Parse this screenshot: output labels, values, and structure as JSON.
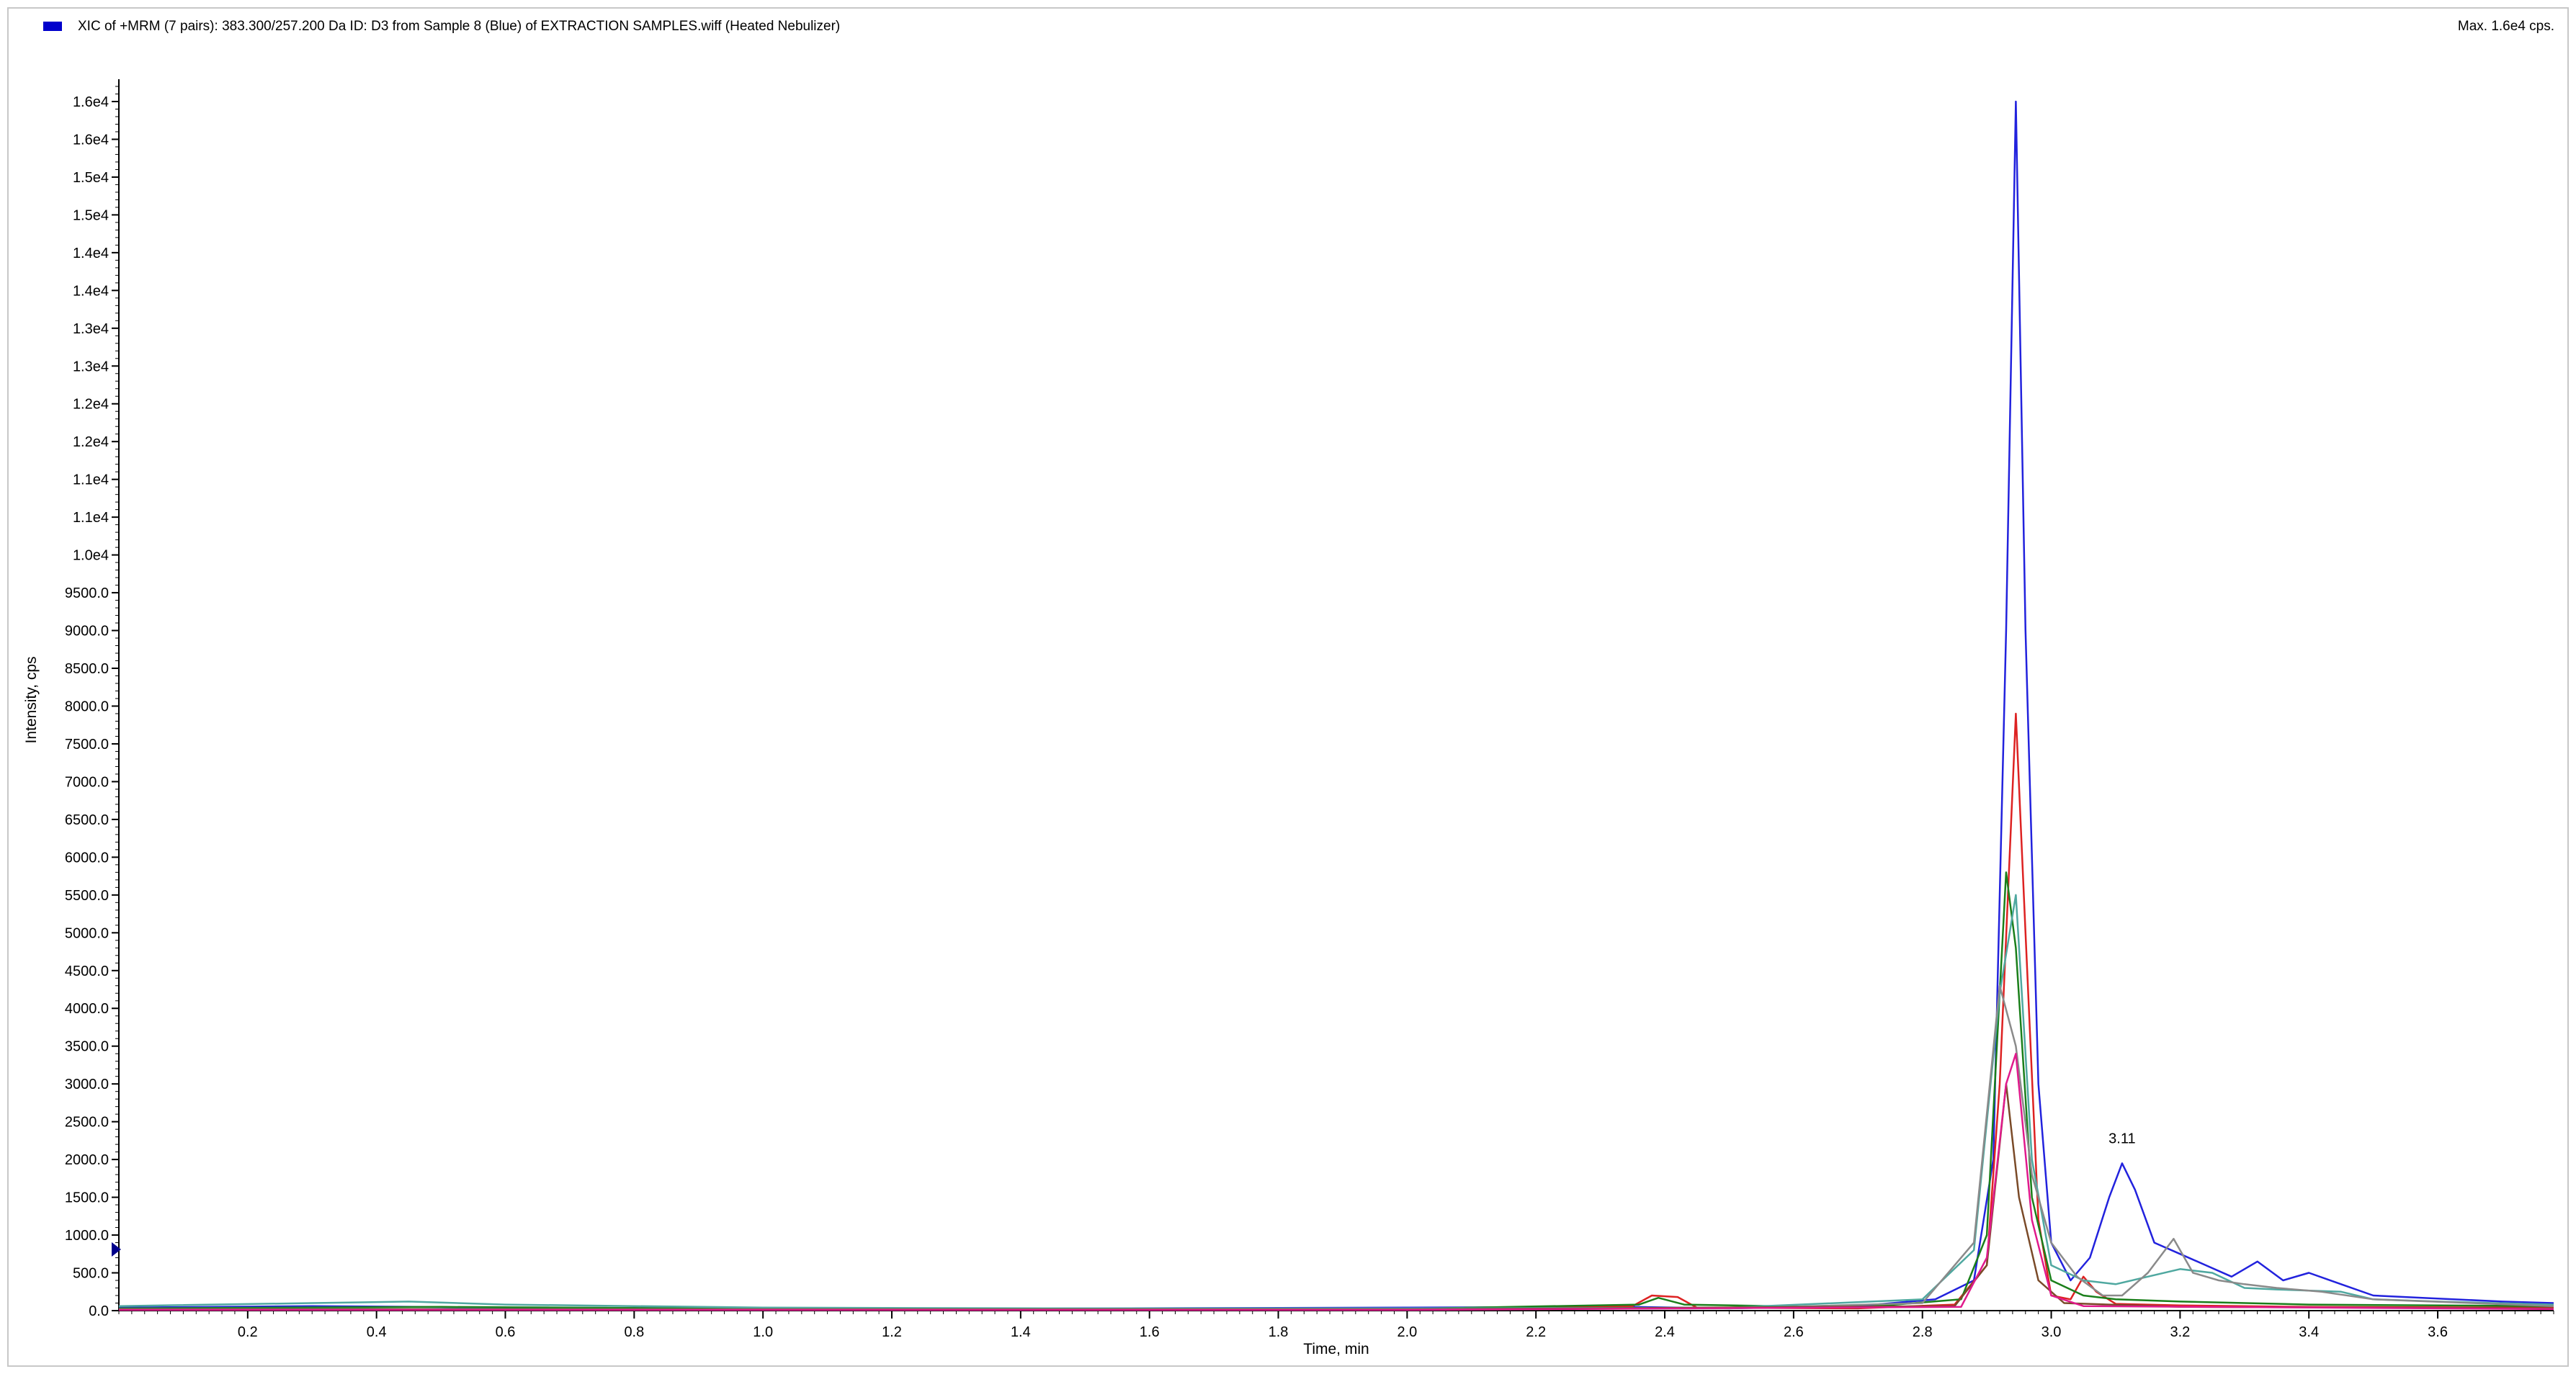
{
  "header": {
    "title": "XIC of +MRM (7 pairs): 383.300/257.200 Da ID: D3 from Sample 8 (Blue) of EXTRACTION SAMPLES.wiff (Heated Nebulizer)",
    "max": "Max. 1.6e4 cps."
  },
  "colors": {
    "legend": "#0000cc"
  },
  "chart_data": {
    "type": "line",
    "xlabel": "Time, min",
    "ylabel": "Intensity, cps",
    "xlim": [
      0.0,
      3.78
    ],
    "ylim": [
      0,
      16200
    ],
    "y_tick_values": [
      0,
      500,
      1000,
      1500,
      2000,
      2500,
      3000,
      3500,
      4000,
      4500,
      5000,
      5500,
      6000,
      6500,
      7000,
      7500,
      8000,
      8500,
      9000,
      9500,
      10000,
      10500,
      11000,
      11500,
      12000,
      12500,
      13000,
      13500,
      14000,
      14500,
      15000,
      15500,
      16000
    ],
    "y_tick_labels": [
      "0.0",
      "500.0",
      "1000.0",
      "1500.0",
      "2000.0",
      "2500.0",
      "3000.0",
      "3500.0",
      "4000.0",
      "4500.0",
      "5000.0",
      "5500.0",
      "6000.0",
      "6500.0",
      "7000.0",
      "7500.0",
      "8000.0",
      "8500.0",
      "9000.0",
      "9500.0",
      "1.0e4",
      "1.1e4",
      "1.1e4",
      "1.2e4",
      "1.2e4",
      "1.3e4",
      "1.3e4",
      "1.4e4",
      "1.4e4",
      "1.5e4",
      "1.5e4",
      "1.6e4",
      "1.6e4"
    ],
    "x_tick_values": [
      0.2,
      0.4,
      0.6,
      0.8,
      1.0,
      1.2,
      1.4,
      1.6,
      1.8,
      2.0,
      2.2,
      2.4,
      2.6,
      2.8,
      3.0,
      3.2,
      3.4,
      3.6
    ],
    "x_tick_labels": [
      "0.2",
      "0.4",
      "0.6",
      "0.8",
      "1.0",
      "1.2",
      "1.4",
      "1.6",
      "1.8",
      "2.0",
      "2.2",
      "2.4",
      "2.6",
      "2.8",
      "3.0",
      "3.2",
      "3.4",
      "3.6"
    ],
    "annotations": [
      {
        "text": "3.11",
        "x": 3.11,
        "y": 2100
      }
    ],
    "series": [
      {
        "color": "#2222dd",
        "points": [
          [
            0,
            40
          ],
          [
            0.3,
            60
          ],
          [
            0.6,
            40
          ],
          [
            1.0,
            30
          ],
          [
            1.5,
            30
          ],
          [
            2.0,
            40
          ],
          [
            2.35,
            50
          ],
          [
            2.5,
            30
          ],
          [
            2.7,
            60
          ],
          [
            2.82,
            150
          ],
          [
            2.88,
            400
          ],
          [
            2.91,
            2000
          ],
          [
            2.93,
            9000
          ],
          [
            2.945,
            16000
          ],
          [
            2.96,
            9000
          ],
          [
            2.98,
            3000
          ],
          [
            3.0,
            900
          ],
          [
            3.03,
            400
          ],
          [
            3.06,
            700
          ],
          [
            3.09,
            1500
          ],
          [
            3.11,
            1950
          ],
          [
            3.13,
            1600
          ],
          [
            3.16,
            900
          ],
          [
            3.2,
            750
          ],
          [
            3.24,
            600
          ],
          [
            3.28,
            450
          ],
          [
            3.32,
            650
          ],
          [
            3.36,
            400
          ],
          [
            3.4,
            500
          ],
          [
            3.45,
            350
          ],
          [
            3.5,
            200
          ],
          [
            3.6,
            160
          ],
          [
            3.7,
            120
          ],
          [
            3.78,
            100
          ]
        ]
      },
      {
        "color": "#dd2222",
        "points": [
          [
            0,
            20
          ],
          [
            1.0,
            15
          ],
          [
            2.0,
            20
          ],
          [
            2.35,
            60
          ],
          [
            2.38,
            200
          ],
          [
            2.42,
            180
          ],
          [
            2.45,
            40
          ],
          [
            2.7,
            30
          ],
          [
            2.85,
            80
          ],
          [
            2.9,
            600
          ],
          [
            2.92,
            3000
          ],
          [
            2.945,
            7900
          ],
          [
            2.96,
            5000
          ],
          [
            2.98,
            1200
          ],
          [
            3.0,
            200
          ],
          [
            3.03,
            150
          ],
          [
            3.05,
            450
          ],
          [
            3.07,
            250
          ],
          [
            3.1,
            90
          ],
          [
            3.2,
            70
          ],
          [
            3.4,
            50
          ],
          [
            3.78,
            40
          ]
        ]
      },
      {
        "color": "#1a7f1a",
        "points": [
          [
            0,
            30
          ],
          [
            0.5,
            50
          ],
          [
            1.0,
            25
          ],
          [
            2.0,
            25
          ],
          [
            2.36,
            80
          ],
          [
            2.39,
            170
          ],
          [
            2.43,
            80
          ],
          [
            2.7,
            40
          ],
          [
            2.86,
            150
          ],
          [
            2.9,
            1000
          ],
          [
            2.93,
            5800
          ],
          [
            2.945,
            4800
          ],
          [
            2.97,
            1500
          ],
          [
            3.0,
            400
          ],
          [
            3.05,
            200
          ],
          [
            3.1,
            150
          ],
          [
            3.2,
            120
          ],
          [
            3.4,
            80
          ],
          [
            3.78,
            60
          ]
        ]
      },
      {
        "color": "#4fa8a0",
        "points": [
          [
            0,
            60
          ],
          [
            0.3,
            100
          ],
          [
            0.45,
            120
          ],
          [
            0.6,
            80
          ],
          [
            1.0,
            40
          ],
          [
            1.5,
            30
          ],
          [
            2.0,
            30
          ],
          [
            2.5,
            40
          ],
          [
            2.8,
            150
          ],
          [
            2.88,
            800
          ],
          [
            2.92,
            4200
          ],
          [
            2.945,
            5500
          ],
          [
            2.97,
            2000
          ],
          [
            3.0,
            600
          ],
          [
            3.05,
            400
          ],
          [
            3.1,
            350
          ],
          [
            3.15,
            450
          ],
          [
            3.2,
            550
          ],
          [
            3.25,
            500
          ],
          [
            3.3,
            300
          ],
          [
            3.35,
            280
          ],
          [
            3.45,
            250
          ],
          [
            3.5,
            150
          ],
          [
            3.6,
            120
          ],
          [
            3.78,
            80
          ]
        ]
      },
      {
        "color": "#8a8a8a",
        "points": [
          [
            0,
            20
          ],
          [
            1.0,
            20
          ],
          [
            2.0,
            20
          ],
          [
            2.5,
            30
          ],
          [
            2.8,
            100
          ],
          [
            2.88,
            900
          ],
          [
            2.92,
            4300
          ],
          [
            2.945,
            3500
          ],
          [
            2.97,
            1800
          ],
          [
            3.0,
            900
          ],
          [
            3.04,
            450
          ],
          [
            3.08,
            200
          ],
          [
            3.11,
            200
          ],
          [
            3.15,
            500
          ],
          [
            3.19,
            950
          ],
          [
            3.22,
            500
          ],
          [
            3.26,
            400
          ],
          [
            3.3,
            350
          ],
          [
            3.35,
            300
          ],
          [
            3.42,
            250
          ],
          [
            3.5,
            150
          ],
          [
            3.78,
            60
          ]
        ]
      },
      {
        "color": "#7a4a28",
        "points": [
          [
            0,
            15
          ],
          [
            1.0,
            15
          ],
          [
            2.0,
            15
          ],
          [
            2.85,
            60
          ],
          [
            2.9,
            600
          ],
          [
            2.93,
            3000
          ],
          [
            2.95,
            1500
          ],
          [
            2.98,
            400
          ],
          [
            3.02,
            100
          ],
          [
            3.2,
            50
          ],
          [
            3.78,
            30
          ]
        ]
      },
      {
        "color": "#e01a8c",
        "points": [
          [
            0,
            10
          ],
          [
            2.0,
            10
          ],
          [
            2.86,
            50
          ],
          [
            2.9,
            700
          ],
          [
            2.93,
            3000
          ],
          [
            2.945,
            3400
          ],
          [
            2.97,
            1200
          ],
          [
            3.0,
            200
          ],
          [
            3.05,
            60
          ],
          [
            3.78,
            20
          ]
        ]
      }
    ]
  }
}
